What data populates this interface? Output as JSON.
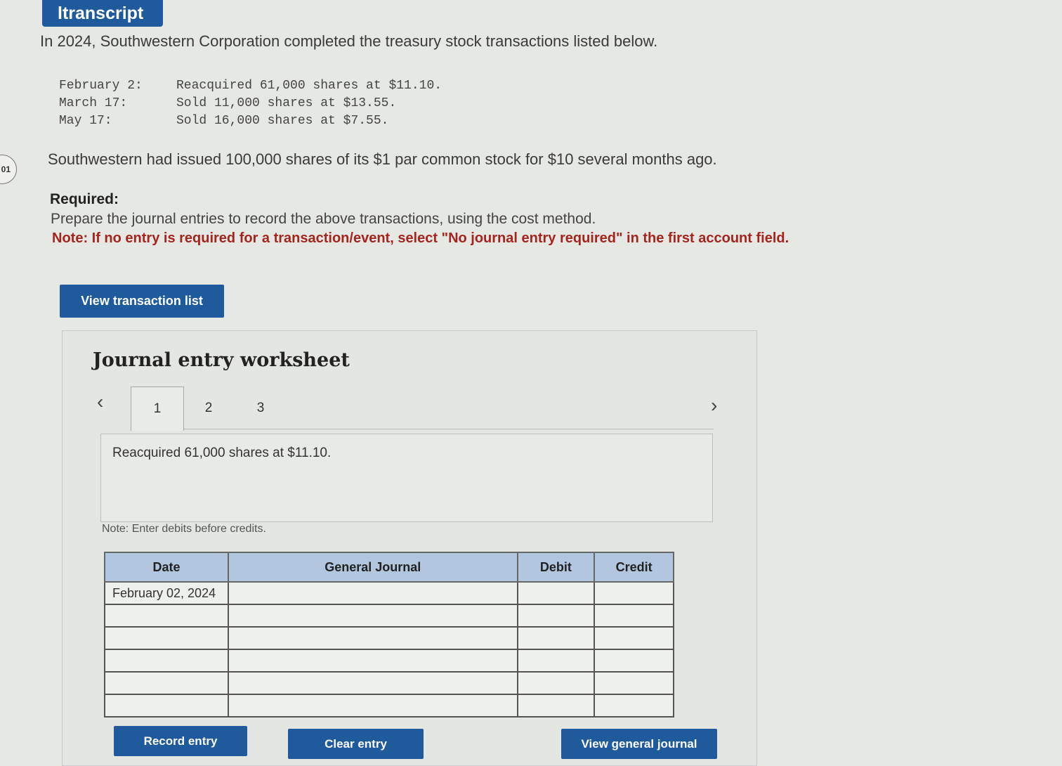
{
  "header": {
    "button_label": "ltranscript"
  },
  "intro": "In 2024, Southwestern Corporation completed the treasury stock transactions listed below.",
  "transactions": [
    {
      "date": "February 2:",
      "desc": "Reacquired 61,000 shares at $11.10."
    },
    {
      "date": "March 17:",
      "desc": "Sold 11,000 shares at $13.55."
    },
    {
      "date": "May 17:",
      "desc": "Sold 16,000 shares at $7.55."
    }
  ],
  "side_label": "01",
  "issued_text": "Southwestern had issued 100,000 shares of its $1 par common stock for $10 several months ago.",
  "required": {
    "title": "Required:",
    "text": "Prepare the journal entries to record the above transactions, using the cost method.",
    "note": "Note: If no entry is required for a transaction/event, select \"No journal entry required\" in the first account field."
  },
  "view_transaction_list": "View transaction list",
  "worksheet": {
    "title": "Journal entry worksheet",
    "tabs": [
      "1",
      "2",
      "3"
    ],
    "active_tab": "1",
    "description": "Reacquired 61,000 shares at $11.10.",
    "note": "Note: Enter debits before credits.",
    "table": {
      "headers": {
        "date": "Date",
        "journal": "General Journal",
        "debit": "Debit",
        "credit": "Credit"
      },
      "rows": [
        {
          "date": "February 02, 2024"
        },
        {
          "date": ""
        },
        {
          "date": ""
        },
        {
          "date": ""
        },
        {
          "date": ""
        },
        {
          "date": ""
        }
      ]
    },
    "buttons": {
      "record": "Record entry",
      "clear": "Clear entry",
      "view_journal": "View general journal"
    }
  }
}
